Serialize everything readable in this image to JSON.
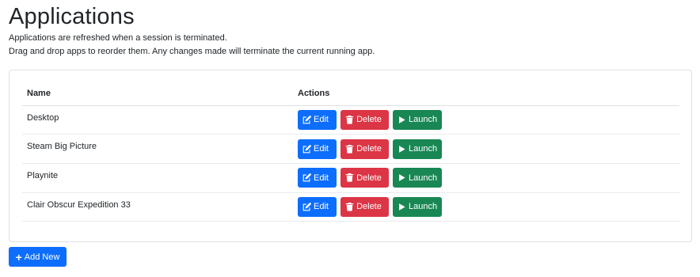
{
  "page": {
    "title": "Applications",
    "description_line1": "Applications are refreshed when a session is terminated.",
    "description_line2": "Drag and drop apps to reorder them. Any changes made will terminate the current running app."
  },
  "table": {
    "columns": [
      "Name",
      "Actions"
    ],
    "rows": [
      {
        "name": "Desktop"
      },
      {
        "name": "Steam Big Picture"
      },
      {
        "name": "Playnite"
      },
      {
        "name": "Clair Obscur Expedition 33"
      }
    ]
  },
  "actions": {
    "edit_label": "Edit",
    "delete_label": "Delete",
    "launch_label": "Launch"
  },
  "add_button": {
    "label": "Add New"
  },
  "colors": {
    "primary": "#0d6efd",
    "danger": "#dc3545",
    "success": "#198754"
  },
  "icons": {
    "edit": "pencil-square-icon",
    "delete": "trash-icon",
    "launch": "play-icon",
    "add": "plus-icon"
  }
}
